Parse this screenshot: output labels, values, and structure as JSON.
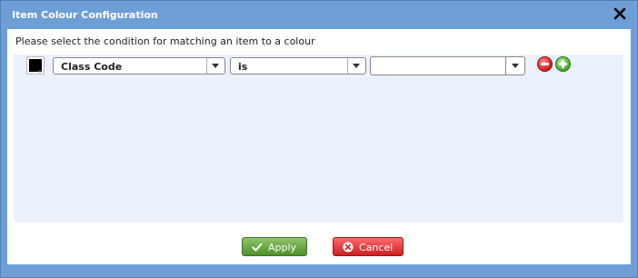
{
  "dialog": {
    "title": "Item Colour Configuration",
    "close_icon": "close-icon",
    "prompt": "Please select the condition for matching an item to a colour"
  },
  "condition_row": {
    "swatch_color": "#000000",
    "field": {
      "selected": "Class Code"
    },
    "operator": {
      "selected": "is"
    },
    "value": {
      "current": "",
      "placeholder": ""
    },
    "remove_icon": "minus-circle-icon",
    "add_icon": "plus-circle-icon"
  },
  "footer": {
    "apply_label": "Apply",
    "cancel_label": "Cancel",
    "apply_icon": "check-icon",
    "cancel_icon": "x-circle-icon"
  },
  "colors": {
    "frame": "#6d9fd6",
    "panel": "#eaf1fb",
    "apply": "#5e9b36",
    "cancel": "#d92b2b"
  }
}
